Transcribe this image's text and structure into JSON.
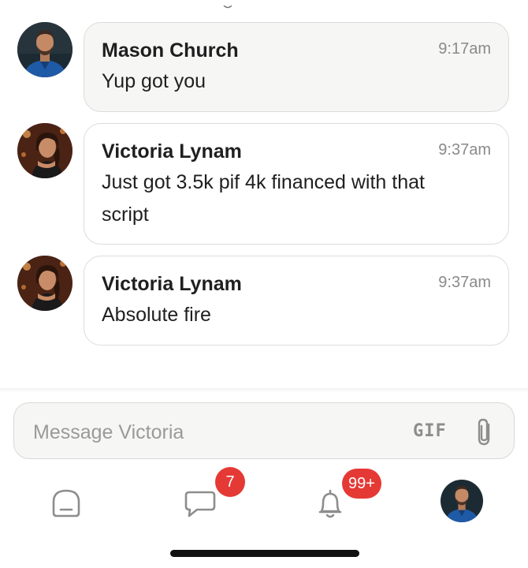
{
  "messages": [
    {
      "sender": "Mason Church",
      "time": "9:17am",
      "text": "Yup got you",
      "avatar": "man-portrait-avatar"
    },
    {
      "sender": "Victoria Lynam",
      "time": "9:37am",
      "text": "Just got 3.5k pif 4k financed with that script",
      "avatar": "woman-portrait-avatar"
    },
    {
      "sender": "Victoria Lynam",
      "time": "9:37am",
      "text": "Absolute fire",
      "avatar": "woman-portrait-avatar"
    }
  ],
  "composer": {
    "placeholder": "Message Victoria",
    "value": "",
    "gif_label": "GIF",
    "attach_icon": "paperclip-icon"
  },
  "tabbar": {
    "home_icon": "home-icon",
    "chat_icon": "chat-bubble-icon",
    "chat_badge": "7",
    "notifications_icon": "bell-icon",
    "notifications_badge": "99+",
    "profile_icon": "profile-avatar"
  },
  "colors": {
    "badge": "#e53935",
    "bubble_border": "#dcdcdc",
    "bubble_grey_bg": "#f6f6f5",
    "timestamp": "#8a8a8a",
    "icon": "#8d8d8d"
  }
}
